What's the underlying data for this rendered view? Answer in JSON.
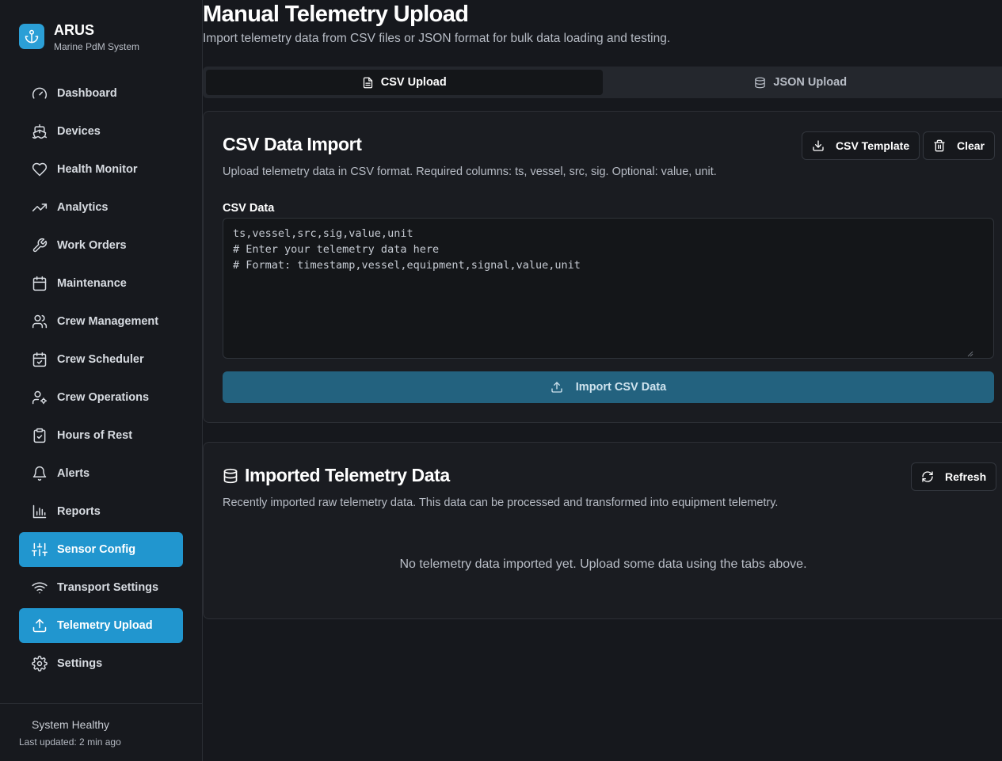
{
  "brand": {
    "name": "ARUS",
    "subtitle": "Marine PdM System"
  },
  "nav": [
    {
      "label": "Dashboard",
      "icon": "gauge-icon",
      "active": false
    },
    {
      "label": "Devices",
      "icon": "ship-icon",
      "active": false
    },
    {
      "label": "Health Monitor",
      "icon": "heart-icon",
      "active": false
    },
    {
      "label": "Analytics",
      "icon": "trending-up-icon",
      "active": false
    },
    {
      "label": "Work Orders",
      "icon": "wrench-icon",
      "active": false
    },
    {
      "label": "Maintenance",
      "icon": "calendar-icon",
      "active": false
    },
    {
      "label": "Crew Management",
      "icon": "users-icon",
      "active": false
    },
    {
      "label": "Crew Scheduler",
      "icon": "calendar-check-icon",
      "active": false
    },
    {
      "label": "Crew Operations",
      "icon": "user-cog-icon",
      "active": false
    },
    {
      "label": "Hours of Rest",
      "icon": "clipboard-check-icon",
      "active": false
    },
    {
      "label": "Alerts",
      "icon": "bell-icon",
      "active": false
    },
    {
      "label": "Reports",
      "icon": "bar-chart-icon",
      "active": false
    },
    {
      "label": "Sensor Config",
      "icon": "sliders-icon",
      "active": true
    },
    {
      "label": "Transport Settings",
      "icon": "wifi-icon",
      "active": false
    },
    {
      "label": "Telemetry Upload",
      "icon": "upload-icon",
      "active": true
    },
    {
      "label": "Settings",
      "icon": "gear-icon",
      "active": false
    }
  ],
  "footer": {
    "status": "System Healthy",
    "updated": "Last updated: 2 min ago"
  },
  "page": {
    "title": "Manual Telemetry Upload",
    "subtitle": "Import telemetry data from CSV files or JSON format for bulk data loading and testing."
  },
  "tabs": [
    {
      "label": "CSV Upload",
      "active": true
    },
    {
      "label": "JSON Upload",
      "active": false
    }
  ],
  "csv_card": {
    "title": "CSV Data Import",
    "description": "Upload telemetry data in CSV format. Required columns: ts, vessel, src, sig. Optional: value, unit.",
    "template_label": "CSV Template",
    "clear_label": "Clear",
    "field_label": "CSV Data",
    "textarea_value": "ts,vessel,src,sig,value,unit\n# Enter your telemetry data here\n# Format: timestamp,vessel,equipment,signal,value,unit",
    "import_label": "Import CSV Data"
  },
  "imported_card": {
    "title": "Imported Telemetry Data",
    "description": "Recently imported raw telemetry data. This data can be processed and transformed into equipment telemetry.",
    "refresh_label": "Refresh",
    "empty_message": "No telemetry data imported yet. Upload some data using the tabs above."
  },
  "colors": {
    "accent": "#2196cf",
    "background": "#16181d",
    "import_button": "#23627f"
  }
}
